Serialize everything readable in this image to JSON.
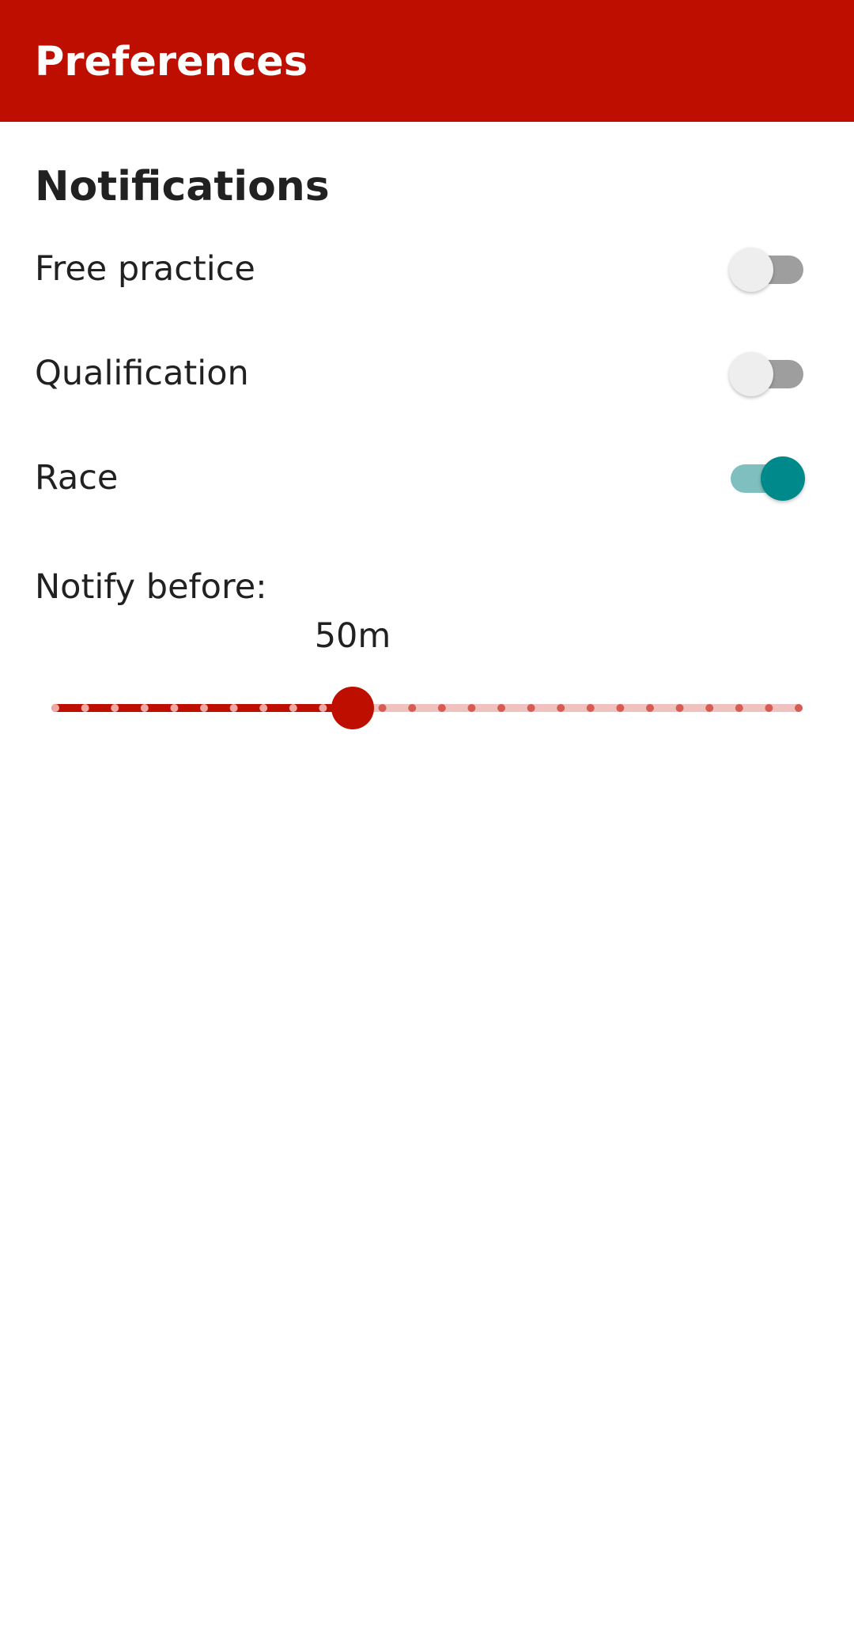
{
  "app_bar": {
    "title": "Preferences",
    "color": "#bd0e00"
  },
  "section": {
    "title": "Notifications"
  },
  "preferences": [
    {
      "label": "Free practice",
      "enabled": false
    },
    {
      "label": "Qualification",
      "enabled": false
    },
    {
      "label": "Race",
      "enabled": true
    }
  ],
  "notify_before": {
    "label": "Notify before:",
    "value_text": "50m",
    "step_index": 10,
    "step_count": 26,
    "active_color": "#bd0e00",
    "inactive_color": "#efc2c0"
  }
}
